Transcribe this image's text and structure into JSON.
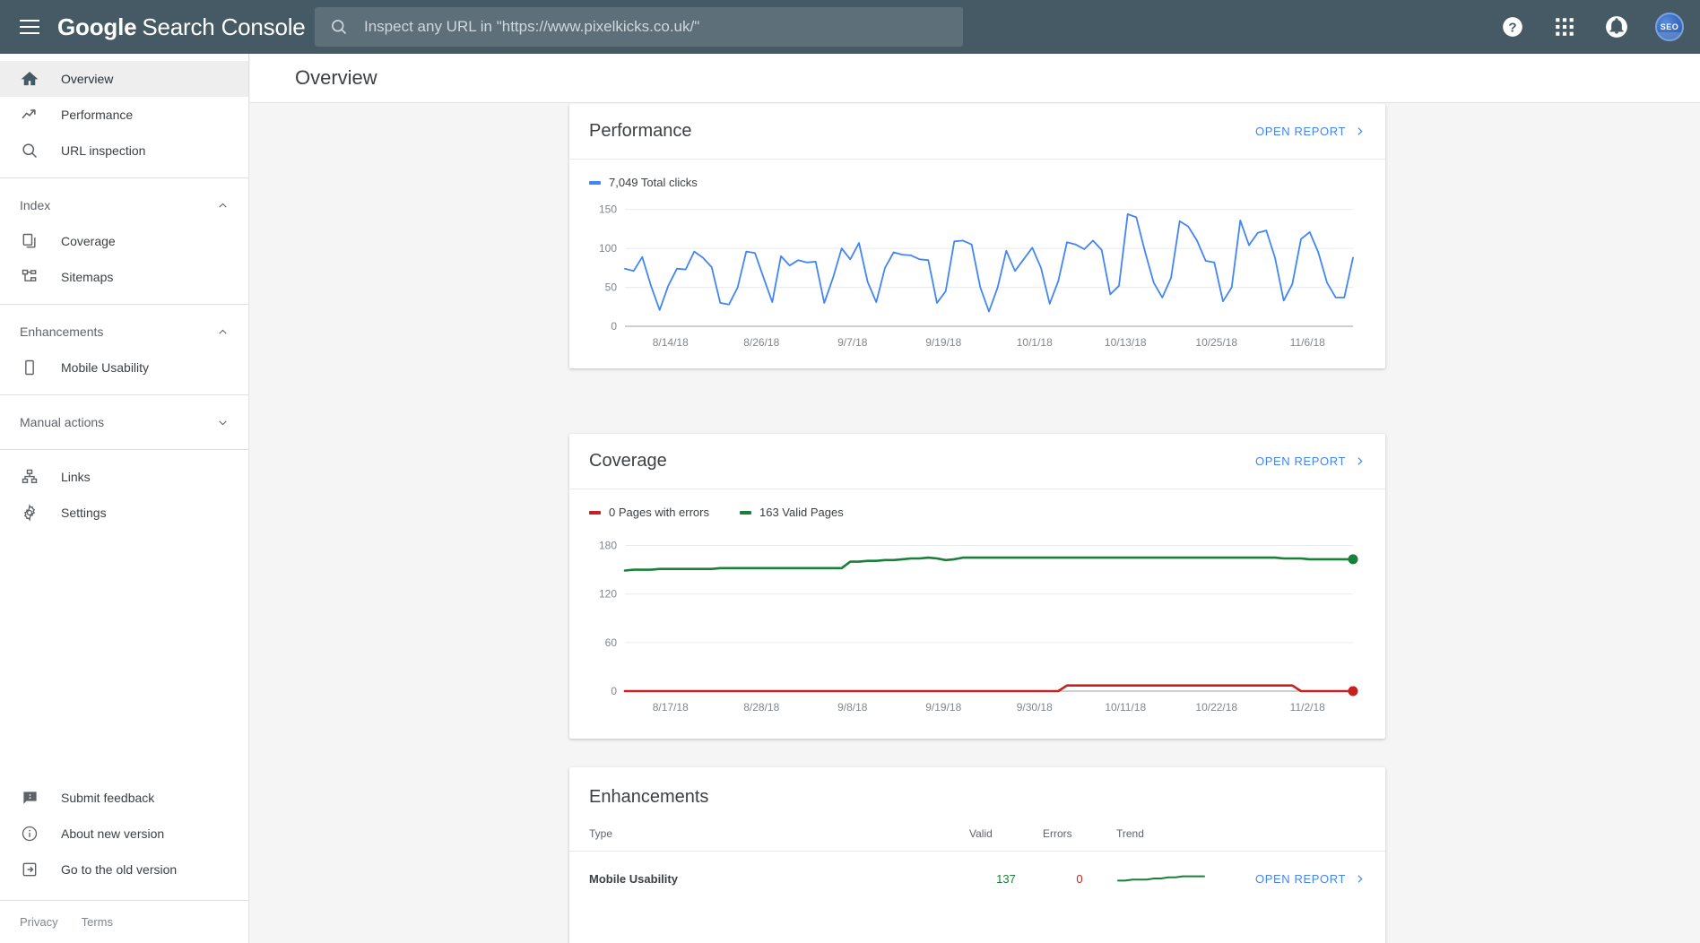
{
  "header": {
    "brand_primary": "Google",
    "brand_secondary": "Search Console",
    "menu_icon": "hamburger-icon",
    "search": {
      "placeholder": "Inspect any URL in \"https://www.pixelkicks.co.uk/\"",
      "value": "",
      "icon": "search-icon"
    },
    "help_icon": "help-circle-icon",
    "apps_icon": "apps-grid-icon",
    "notifications_icon": "bell-icon",
    "avatar_label": "SEO",
    "bar_color": "#455a64"
  },
  "sidebar": {
    "primary": [
      {
        "label": "Overview",
        "icon": "home-icon",
        "active": true
      },
      {
        "label": "Performance",
        "icon": "trending-up-icon",
        "active": false
      },
      {
        "label": "URL inspection",
        "icon": "search-icon",
        "active": false
      }
    ],
    "groups": [
      {
        "title": "Index",
        "expanded": true,
        "chevron": "chevron-up-icon",
        "items": [
          {
            "label": "Coverage",
            "icon": "pages-copy-icon"
          },
          {
            "label": "Sitemaps",
            "icon": "sitemap-icon"
          }
        ]
      },
      {
        "title": "Enhancements",
        "expanded": true,
        "chevron": "chevron-up-icon",
        "items": [
          {
            "label": "Mobile Usability",
            "icon": "mobile-phone-icon"
          }
        ]
      },
      {
        "title": "Manual actions",
        "expanded": false,
        "chevron": "chevron-down-icon",
        "items": []
      }
    ],
    "secondary": [
      {
        "label": "Links",
        "icon": "links-hierarchy-icon"
      },
      {
        "label": "Settings",
        "icon": "gear-icon"
      }
    ],
    "bottom": [
      {
        "label": "Submit feedback",
        "icon": "feedback-icon"
      },
      {
        "label": "About new version",
        "icon": "info-circle-icon"
      },
      {
        "label": "Go to the old version",
        "icon": "exit-arrow-icon"
      }
    ],
    "legal": [
      {
        "label": "Privacy"
      },
      {
        "label": "Terms"
      }
    ]
  },
  "page": {
    "title": "Overview"
  },
  "cards": {
    "performance": {
      "title": "Performance",
      "open_report": "OPEN REPORT",
      "chevron": "chevron-right-icon",
      "legend": [
        {
          "label": "7,049 Total clicks",
          "color": "#4285f4"
        }
      ]
    },
    "coverage": {
      "title": "Coverage",
      "open_report": "OPEN REPORT",
      "chevron": "chevron-right-icon",
      "legend": [
        {
          "label": "0 Pages with errors",
          "color": "#c5221f"
        },
        {
          "label": "163 Valid Pages",
          "color": "#188038"
        }
      ]
    },
    "enhancements": {
      "title": "Enhancements",
      "columns": [
        "Type",
        "Valid",
        "Errors",
        "Trend"
      ],
      "rows": [
        {
          "type": "Mobile Usability",
          "valid": "137",
          "errors": "0",
          "open_report": "OPEN REPORT",
          "chevron": "chevron-right-icon"
        }
      ]
    }
  },
  "chart_data": [
    {
      "id": "performance",
      "type": "line",
      "title": "Performance",
      "xlabel": "",
      "ylabel": "Total clicks",
      "ylim": [
        0,
        160
      ],
      "yticks": [
        0,
        50,
        100,
        150
      ],
      "grid": true,
      "legend_position": "top-left",
      "tick_labels": [
        "8/14/18",
        "8/26/18",
        "9/7/18",
        "9/19/18",
        "10/1/18",
        "10/13/18",
        "10/25/18",
        "11/6/18"
      ],
      "series": [
        {
          "name": "Total clicks",
          "color": "#4285f4",
          "total": 7049,
          "values": [
            74,
            71,
            89,
            52,
            21,
            52,
            74,
            73,
            96,
            88,
            76,
            30,
            28,
            50,
            96,
            94,
            62,
            31,
            90,
            78,
            85,
            82,
            83,
            30,
            62,
            100,
            86,
            107,
            57,
            31,
            75,
            95,
            92,
            91,
            86,
            85,
            30,
            45,
            109,
            110,
            105,
            50,
            19,
            50,
            97,
            71,
            86,
            101,
            75,
            29,
            58,
            108,
            105,
            99,
            110,
            98,
            41,
            52,
            144,
            140,
            96,
            56,
            37,
            62,
            135,
            128,
            110,
            84,
            82,
            32,
            50,
            136,
            104,
            120,
            123,
            88,
            33,
            54,
            112,
            121,
            95,
            56,
            37,
            37,
            88
          ]
        }
      ]
    },
    {
      "id": "coverage",
      "type": "line",
      "title": "Coverage",
      "xlabel": "",
      "ylabel": "Pages",
      "ylim": [
        0,
        195
      ],
      "yticks": [
        0,
        60,
        120,
        180
      ],
      "grid": true,
      "legend_position": "top-left",
      "tick_labels": [
        "8/17/18",
        "8/28/18",
        "9/8/18",
        "9/19/18",
        "9/30/18",
        "10/11/18",
        "10/22/18",
        "11/2/18"
      ],
      "series": [
        {
          "name": "Valid Pages",
          "color": "#188038",
          "total": 163,
          "end_marker": true,
          "values": [
            149,
            150,
            150,
            150,
            151,
            151,
            151,
            151,
            151,
            151,
            151,
            152,
            152,
            152,
            152,
            152,
            152,
            152,
            152,
            152,
            152,
            152,
            152,
            152,
            152,
            152,
            160,
            160,
            161,
            161,
            162,
            162,
            163,
            164,
            164,
            165,
            164,
            162,
            163,
            165,
            165,
            165,
            165,
            165,
            165,
            165,
            165,
            165,
            165,
            165,
            165,
            165,
            165,
            165,
            165,
            165,
            165,
            165,
            165,
            165,
            165,
            165,
            165,
            165,
            165,
            165,
            165,
            165,
            165,
            165,
            165,
            165,
            165,
            165,
            165,
            165,
            164,
            164,
            164,
            163,
            163,
            163,
            163,
            163,
            163
          ]
        },
        {
          "name": "Pages with errors",
          "color": "#c5221f",
          "total": 0,
          "end_marker": true,
          "values": [
            0,
            0,
            0,
            0,
            0,
            0,
            0,
            0,
            0,
            0,
            0,
            0,
            0,
            0,
            0,
            0,
            0,
            0,
            0,
            0,
            0,
            0,
            0,
            0,
            0,
            0,
            0,
            0,
            0,
            0,
            0,
            0,
            0,
            0,
            0,
            0,
            0,
            0,
            0,
            0,
            0,
            0,
            0,
            0,
            0,
            0,
            0,
            0,
            0,
            0,
            0,
            7,
            7,
            7,
            7,
            7,
            7,
            7,
            7,
            7,
            7,
            7,
            7,
            7,
            7,
            7,
            7,
            7,
            7,
            7,
            7,
            7,
            7,
            7,
            7,
            7,
            7,
            7,
            0,
            0,
            0,
            0,
            0,
            0,
            0
          ]
        }
      ]
    },
    {
      "id": "mobile-usability-trend",
      "type": "line",
      "title": "Trend",
      "grid": false,
      "ylim": [
        130,
        140
      ],
      "series": [
        {
          "name": "Valid",
          "color": "#188038",
          "values": [
            133,
            133,
            134,
            134,
            134,
            135,
            135,
            136,
            136,
            137,
            137,
            137,
            137
          ]
        }
      ]
    }
  ]
}
